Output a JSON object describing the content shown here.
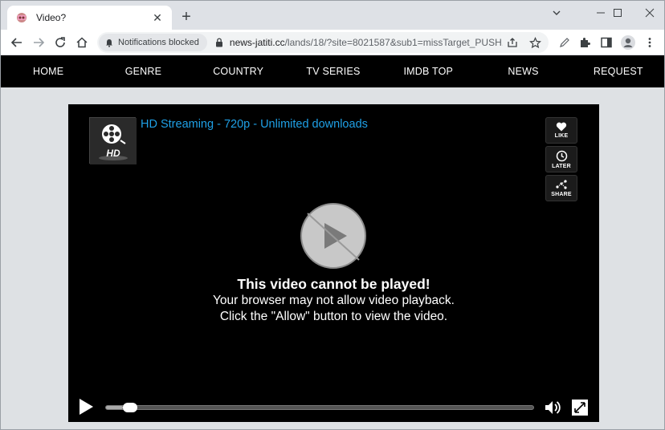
{
  "browser": {
    "tab_title": "Video?",
    "tab_close": "✕",
    "new_tab": "+",
    "notification_chip": "Notifications blocked",
    "url_host": "news-jatiti.cc",
    "url_path": "/lands/18/?site=8021587&sub1=missTarget_PUSH..."
  },
  "nav": {
    "items": [
      "HOME",
      "GENRE",
      "COUNTRY",
      "TV SERIES",
      "IMDB TOP",
      "NEWS",
      "REQUEST"
    ]
  },
  "player": {
    "stream_title": "HD Streaming - 720p - Unlimited downloads",
    "thumb_label": "HD",
    "like_label": "LIKE",
    "later_label": "LATER",
    "share_label": "SHARE",
    "heading": "This video cannot be played!",
    "line1": "Your browser may not allow video playback.",
    "line2": "Click the \"Allow\" button to view the video.",
    "progress": 0.04
  },
  "colors": {
    "accent": "#1fa0e6",
    "nav_bg": "#000000",
    "page_bg": "#dee1e4"
  }
}
